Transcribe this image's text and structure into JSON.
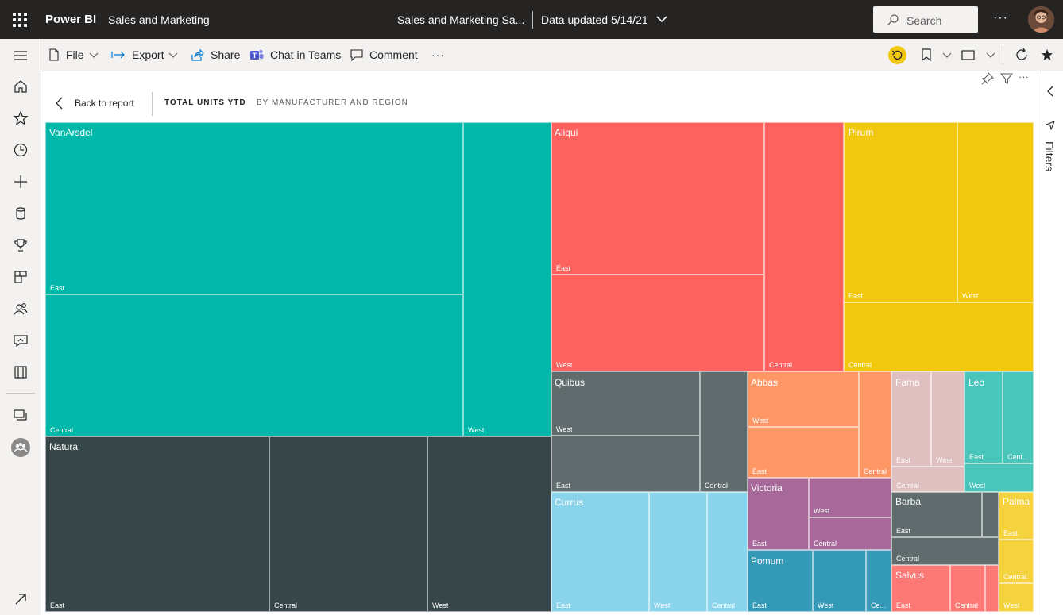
{
  "topbar": {
    "brand": "Power BI",
    "workspace": "Sales and Marketing",
    "doc_title": "Sales and Marketing Sa...",
    "data_updated": "Data updated 5/14/21",
    "search_placeholder": "Search",
    "more": "···"
  },
  "toolbar": {
    "file": "File",
    "export": "Export",
    "share": "Share",
    "chat": "Chat in Teams",
    "comment": "Comment",
    "more": "···"
  },
  "nav": {
    "icons": [
      "menu-icon",
      "home-icon",
      "favorites-star-icon",
      "recent-clock-icon",
      "create-plus-icon",
      "datasets-icon",
      "goals-trophy-icon",
      "apps-icon",
      "shared-people-icon",
      "learn-icon",
      "workspaces-book-icon",
      "deployment-pipelines-icon",
      "workspace-avatar",
      "expand-arrow-icon"
    ]
  },
  "visual_header": {
    "back_label": "Back to report",
    "title": "TOTAL UNITS YTD",
    "subtitle": "BY MANUFACTURER AND REGION",
    "more": "···"
  },
  "filters_pane": {
    "label": "Filters"
  },
  "colors": {
    "VanArsdel": "#01b8aa",
    "Natura": "#374649",
    "Aliqui": "#fd625e",
    "Pirum": "#f2c80f",
    "Quibus": "#5f6b6d",
    "Currus": "#8ad4eb",
    "Abbas": "#fe9666",
    "Fama": "#dfbfbf",
    "Leo": "#4ac5bb",
    "Victoria": "#a66999",
    "Barba": "#5f6b6d",
    "Palma": "#f5d33f",
    "Pomum": "#3599b8",
    "Salvus": "#fd7976"
  },
  "chart_data": {
    "type": "treemap",
    "title": "TOTAL UNITS YTD",
    "subtitle": "BY MANUFACTURER AND REGION",
    "groups": [
      {
        "name": "VanArsdel",
        "children": [
          {
            "name": "East"
          },
          {
            "name": "Central"
          },
          {
            "name": "West"
          }
        ]
      },
      {
        "name": "Natura",
        "children": [
          {
            "name": "East"
          },
          {
            "name": "Central"
          },
          {
            "name": "West"
          }
        ]
      },
      {
        "name": "Aliqui",
        "children": [
          {
            "name": "East"
          },
          {
            "name": "West"
          },
          {
            "name": "Central"
          }
        ]
      },
      {
        "name": "Pirum",
        "children": [
          {
            "name": "East"
          },
          {
            "name": "West"
          },
          {
            "name": "Central"
          }
        ]
      },
      {
        "name": "Quibus",
        "children": [
          {
            "name": "West"
          },
          {
            "name": "East"
          },
          {
            "name": "Central"
          }
        ]
      },
      {
        "name": "Currus",
        "children": [
          {
            "name": "East"
          },
          {
            "name": "West"
          },
          {
            "name": "Central"
          }
        ]
      },
      {
        "name": "Abbas",
        "children": [
          {
            "name": "West"
          },
          {
            "name": "East"
          },
          {
            "name": "Central"
          }
        ]
      },
      {
        "name": "Fama",
        "children": [
          {
            "name": "East"
          },
          {
            "name": "West"
          },
          {
            "name": "Central"
          }
        ]
      },
      {
        "name": "Leo",
        "children": [
          {
            "name": "East"
          },
          {
            "name": "Cent..."
          },
          {
            "name": "West"
          }
        ]
      },
      {
        "name": "Victoria",
        "children": [
          {
            "name": "West"
          },
          {
            "name": "East"
          },
          {
            "name": "Central"
          }
        ]
      },
      {
        "name": "Barba",
        "children": [
          {
            "name": "East"
          },
          {
            "name": "Central"
          }
        ]
      },
      {
        "name": "Palma",
        "children": [
          {
            "name": "East"
          },
          {
            "name": "Central"
          },
          {
            "name": "West"
          }
        ]
      },
      {
        "name": "Pomum",
        "children": [
          {
            "name": "East"
          },
          {
            "name": "West"
          },
          {
            "name": "Ce..."
          }
        ]
      },
      {
        "name": "Salvus",
        "children": [
          {
            "name": "East"
          },
          {
            "name": "Central"
          }
        ]
      }
    ]
  }
}
